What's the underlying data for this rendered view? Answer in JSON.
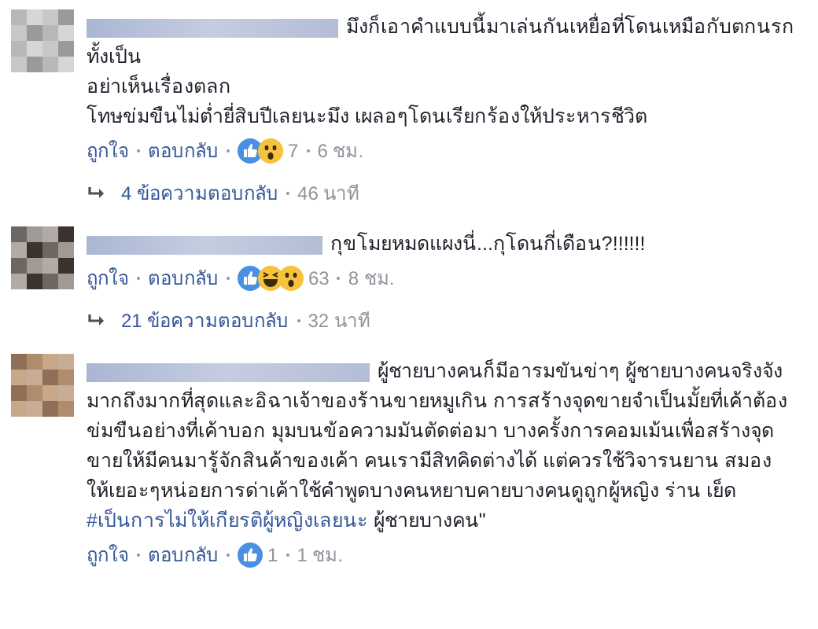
{
  "comments": [
    {
      "body": [
        {
          "kind": "text",
          "text": "มึงก็เอาคำแบบนี้มาเล่นกันเหยื่อที่โดนเหมือกับตกนรกทั้งเป็น\nอย่าเห็นเรื่องตลก\nโทษข่มขืนไม่ต่ำยี่สิบปีเลยนะมึง เผลอๆโดนเรียกร้องให้ประหารชีวิต"
        }
      ],
      "like": "ถูกใจ",
      "reply": "ตอบกลับ",
      "reactions": [
        {
          "kind": "like"
        },
        {
          "kind": "wow"
        }
      ],
      "count": "7",
      "time": "6 ชม.",
      "replies": {
        "label": "4 ข้อความตอบกลับ",
        "time": "46 นาที"
      }
    },
    {
      "body": [
        {
          "kind": "text",
          "text": "กุขโมยหมดแผงนี่...กุโดนกี่เดือน?!!!!!!"
        }
      ],
      "like": "ถูกใจ",
      "reply": "ตอบกลับ",
      "reactions": [
        {
          "kind": "like"
        },
        {
          "kind": "haha"
        },
        {
          "kind": "wow"
        }
      ],
      "count": "63",
      "time": "8 ชม.",
      "replies": {
        "label": "21 ข้อความตอบกลับ",
        "time": "32 นาที"
      }
    },
    {
      "body": [
        {
          "kind": "text",
          "text": "ผู้ชายบางคนก็มีอารมขันข่าๆ ผู้ชายบางคนจริงจังมากถึงมากที่สุดและอิฉาเจ้าของร้านขายหมูเกิน การสร้างจุดขายจำเป็นมั้ยที่เค้าต้องข่มขืนอย่างที่เค้าบอก มุมบนข้อความมันตัดต่อมา บางครั้งการคอมเม้นเพื่อสร้างจุดขายให้มีคนมารู้จักสินค้าของเค้า คนเรามีสิทคิดต่างได้ แต่ควรใช้วิจารนยาน สมอง ให้เยอะๆหน่อยการด่าเค้าใช้คำพูดบางคนหยาบคายบางคนดูถูกผู้หญิง ร่าน เย็ด "
        },
        {
          "kind": "hashtag",
          "text": "#เป็นการไม่ให้เกียรติผู้หญิงเลยนะ"
        },
        {
          "kind": "text",
          "text": " ผู้ชายบางคน\""
        }
      ],
      "like": "ถูกใจ",
      "reply": "ตอบกลับ",
      "reactions": [
        {
          "kind": "like"
        }
      ],
      "count": "1",
      "time": "1 ชม."
    }
  ]
}
